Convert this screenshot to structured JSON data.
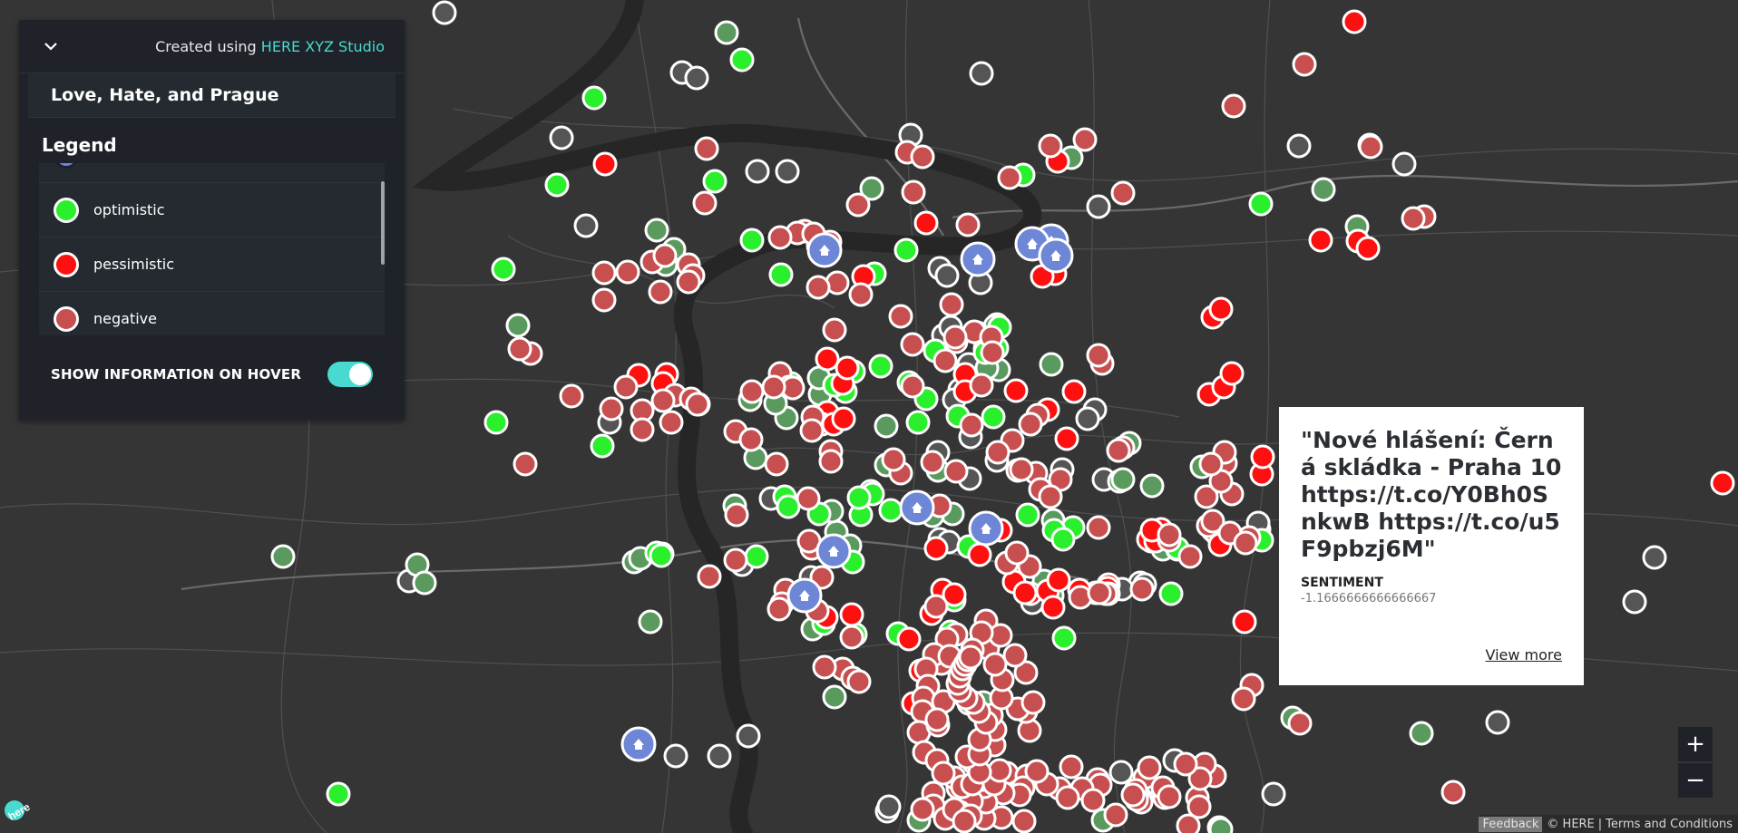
{
  "panel": {
    "credit_prefix": "Created using",
    "credit_link": "HERE XYZ Studio",
    "title": "Love, Hate, and Prague",
    "legend_title": "Legend",
    "legend_items": [
      {
        "label": "optimistic",
        "color": "#29ef2c"
      },
      {
        "label": "pessimistic",
        "color": "#ff1010"
      },
      {
        "label": "negative",
        "color": "#c74f4f"
      }
    ],
    "hover_label": "SHOW INFORMATION ON HOVER",
    "hover_enabled": true
  },
  "popup": {
    "text": "\"Nové hlášení: Černá skládka - Praha 10 https://t.co/Y0Bh0SnkwB https://t.co/u5F9pbzj6M\"",
    "field_label": "SENTIMENT",
    "field_value": "-1.1666666666666667",
    "more_label": "View more"
  },
  "zoom": {
    "in_label": "+",
    "out_label": "−"
  },
  "attribution": {
    "feedback": "Feedback",
    "copyright": "© HERE",
    "separator": "|",
    "terms": "Terms and Conditions"
  },
  "logo_text": "here",
  "colors": {
    "optimistic": "#29ef2c",
    "positive": "#5a9a5e",
    "pessimistic": "#ff1010",
    "negative": "#c74f4f",
    "neutral": "#555555",
    "home": "#6d86d6",
    "accent": "#48dad0"
  }
}
